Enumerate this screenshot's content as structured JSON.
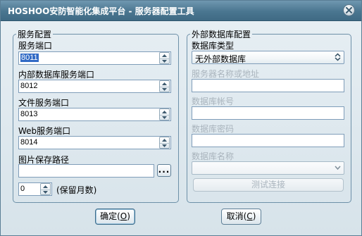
{
  "window": {
    "title": "HOSHOO安防智能化集成平台 - 服务器配置工具"
  },
  "service_config": {
    "legend": "服务配置",
    "service_port_label": "服务端口",
    "service_port_value": "8011",
    "db_port_label": "内部数据库服务端口",
    "db_port_value": "8012",
    "file_port_label": "文件服务端口",
    "file_port_value": "8013",
    "web_port_label": "Web服务端口",
    "web_port_value": "8014",
    "image_path_label": "图片保存路径",
    "image_path_value": "",
    "browse_label": "...",
    "retention_value": "0",
    "retention_label": "(保留月数)"
  },
  "external_db": {
    "legend": "外部数据库配置",
    "db_type_label": "数据库类型",
    "db_type_value": "无外部数据库",
    "server_name_label": "服务器名称或地址",
    "server_name_value": "",
    "db_account_label": "数据库帐号",
    "db_account_value": "",
    "db_password_label": "数据库密码",
    "db_password_value": "",
    "db_name_label": "数据库名称",
    "db_name_value": "",
    "test_connection_label": "测试连接"
  },
  "buttons": {
    "ok_label": "确定(",
    "ok_key": "O",
    "ok_suffix": ")",
    "cancel_label": "取消(",
    "cancel_key": "C",
    "cancel_suffix": ")"
  }
}
